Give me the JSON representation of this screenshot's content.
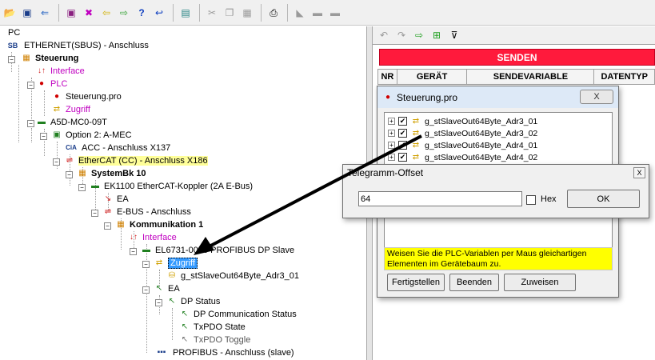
{
  "toolbar": {
    "icons": [
      "open-folder-icon",
      "save-icon",
      "import-icon",
      "save-as-icon",
      "delete-icon",
      "back-icon",
      "forward-icon",
      "help-icon",
      "context-help-icon",
      "calculator-icon",
      "cut-icon",
      "copy-icon",
      "paste-icon",
      "print-icon",
      "property-icon",
      "tool-a-icon",
      "tool-b-icon"
    ]
  },
  "tree": {
    "nodes": [
      {
        "label": "PC"
      },
      {
        "label": "ETHERNET(SBUS) - Anschluss"
      },
      {
        "label": "Steuerung"
      },
      {
        "label": "Interface"
      },
      {
        "label": "PLC"
      },
      {
        "label": "Steuerung.pro"
      },
      {
        "label": "Zugriff"
      },
      {
        "label": "A5D-MC0-09T"
      },
      {
        "label": "Option 2: A-MEC"
      },
      {
        "label": "ACC - Anschluss X137"
      },
      {
        "label": "EtherCAT (CC) - Anschluss X186"
      },
      {
        "label": "SystemBk 10"
      },
      {
        "label": "EK1100 EtherCAT-Koppler (2A E-Bus)"
      },
      {
        "label": "EA"
      },
      {
        "label": "E-BUS - Anschluss"
      },
      {
        "label": "Kommunikation 1"
      },
      {
        "label": "Interface"
      },
      {
        "label": "EL6731-0010 PROFIBUS DP Slave"
      },
      {
        "label": "Zugriff"
      },
      {
        "label": "g_stSlaveOut64Byte_Adr3_01"
      },
      {
        "label": "EA"
      },
      {
        "label": "DP Status"
      },
      {
        "label": "DP Communication Status"
      },
      {
        "label": "TxPDO State"
      },
      {
        "label": "TxPDO Toggle"
      },
      {
        "label": "PROFIBUS - Anschluss   (slave)"
      }
    ],
    "sb_tag": "SB",
    "cia_tag": "CiA"
  },
  "right_panel": {
    "send_button": "SENDEN",
    "columns": [
      "NR",
      "GERÄT",
      "SENDEVARIABLE",
      "DATENTYP"
    ]
  },
  "variable_window": {
    "title": "Steuerung.pro",
    "close_label": "X",
    "variables": [
      "g_stSlaveOut64Byte_Adr3_01",
      "g_stSlaveOut64Byte_Adr3_02",
      "g_stSlaveOut64Byte_Adr4_01",
      "g_stSlaveOut64Byte_Adr4_02"
    ],
    "hint": "Weisen Sie die PLC-Variablen per Maus gleichartigen Elementen im Gerätebaum zu.",
    "buttons": [
      "Fertigstellen",
      "Beenden",
      "Zuweisen"
    ]
  },
  "offset_dialog": {
    "title": "Telegramm-Offset",
    "value": "64",
    "hex_label": "Hex",
    "hex_checked": false,
    "ok_label": "OK",
    "close_label": "X"
  },
  "colors": {
    "send_bar": "#ff1a3c",
    "hint_bg": "#ffff00",
    "selection": "#3399ff",
    "highlight": "#ffff99",
    "magenta_label": "#c000c0"
  }
}
